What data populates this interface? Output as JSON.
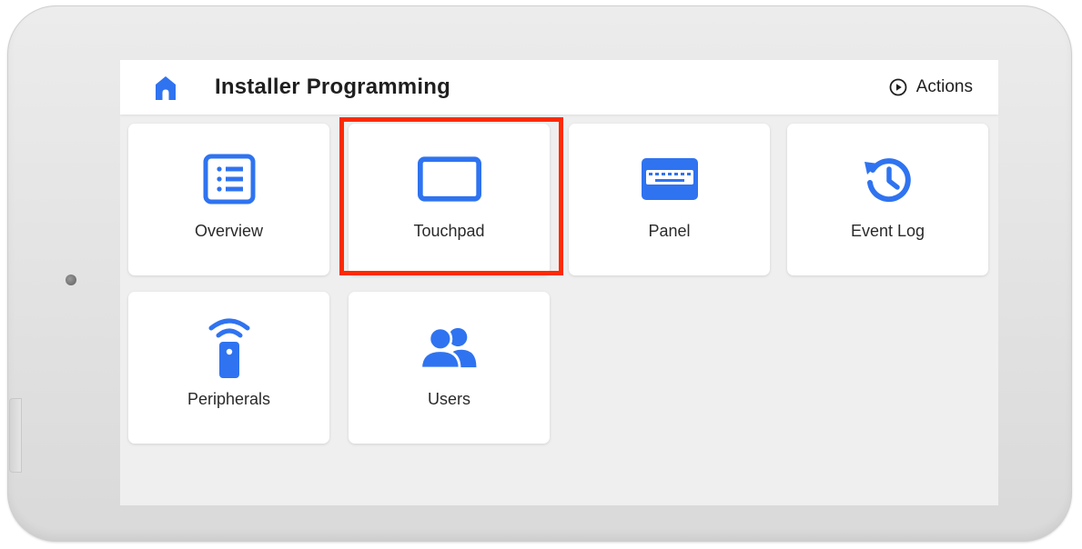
{
  "header": {
    "title": "Installer Programming",
    "home_icon": "home-icon",
    "actions_label": "Actions",
    "actions_icon": "play-circle-icon"
  },
  "tiles": [
    {
      "label": "Overview",
      "icon": "list-icon"
    },
    {
      "label": "Touchpad",
      "icon": "tablet-icon",
      "highlighted": true
    },
    {
      "label": "Panel",
      "icon": "keyboard-icon"
    },
    {
      "label": "Event Log",
      "icon": "history-icon"
    },
    {
      "label": "Peripherals",
      "icon": "remote-wireless-icon"
    },
    {
      "label": "Users",
      "icon": "users-icon"
    }
  ],
  "colors": {
    "accent": "#2f73f0",
    "highlight": "#ff2a00",
    "title_text": "#1f1f1f",
    "background": "#efefef"
  }
}
